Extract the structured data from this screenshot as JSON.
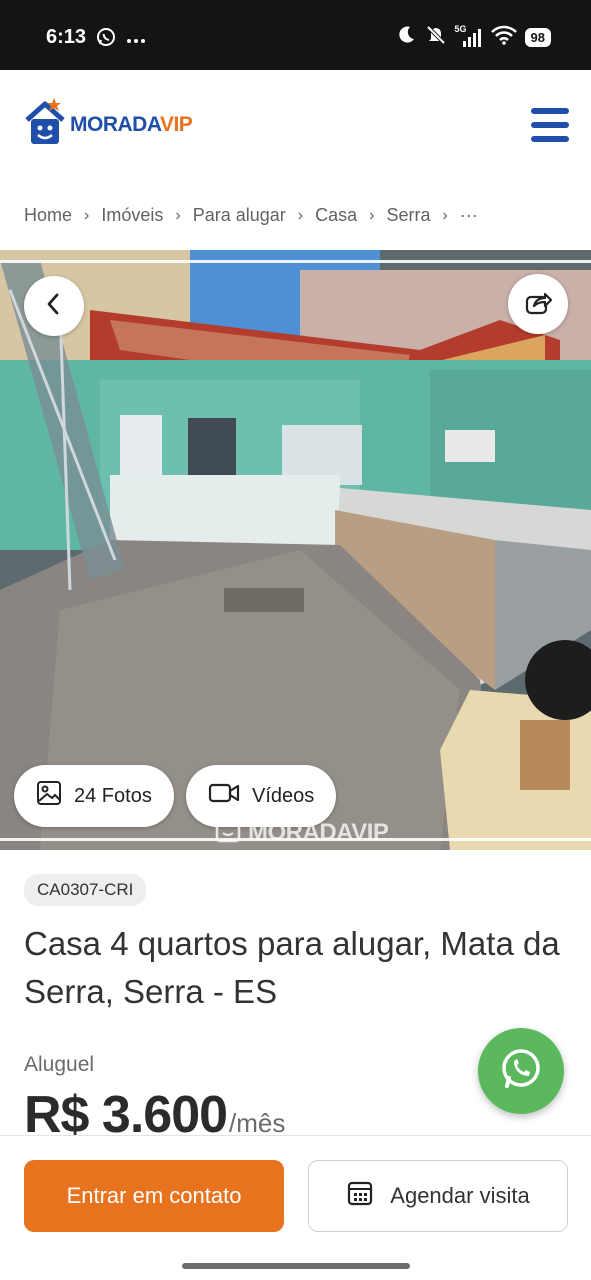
{
  "status_bar": {
    "time": "6:13",
    "left_icons": [
      "whatsapp-icon",
      "more-icon"
    ],
    "right_icons": [
      "moon-icon",
      "mute-icon",
      "signal-icon",
      "wifi-icon"
    ],
    "network": "5G",
    "battery": "98"
  },
  "header": {
    "logo_morada": "MORADA",
    "logo_vip": "VIP",
    "menu_icon": "hamburger-menu-icon",
    "brand_blue": "#1f4fa8",
    "brand_orange": "#e8731e"
  },
  "breadcrumb": [
    "Home",
    "Imóveis",
    "Para alugar",
    "Casa",
    "Serra",
    "···"
  ],
  "gallery": {
    "back_icon": "chevron-left-icon",
    "share_icon": "share-icon",
    "photos_label": "24 Fotos",
    "videos_label": "Vídeos",
    "watermark_morada": "MORADA",
    "watermark_vip": "VIP"
  },
  "listing": {
    "code": "CA0307-CRI",
    "title": "Casa 4 quartos para alugar, Mata da Serra, Serra - ES",
    "price_label": "Aluguel",
    "price_value": "R$ 3.600",
    "price_unit": "/mês"
  },
  "actions": {
    "whatsapp_color": "#5cb85c",
    "contact_label": "Entrar em contato",
    "visit_label": "Agendar visita"
  }
}
